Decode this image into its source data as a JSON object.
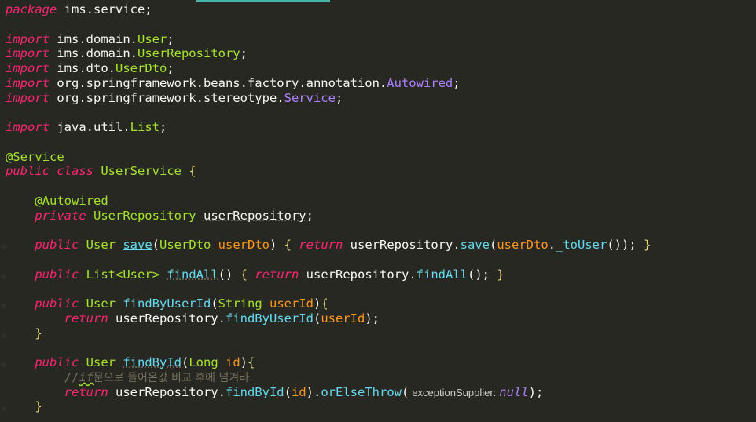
{
  "code": {
    "l1_kw": "package",
    "l1_name": " ims.service;",
    "import_kw": "import",
    "l3_pkg": " ims.domain.",
    "l3_cls": "User",
    "l3_semi": ";",
    "l4_pkg": " ims.domain.",
    "l4_cls": "UserRepository",
    "l4_semi": ";",
    "l5_pkg": " ims.dto.",
    "l5_cls": "UserDto",
    "l5_semi": ";",
    "l6_pkg": " org.springframework.beans.factory.annotation.",
    "l6_cls": "Autowired",
    "l6_semi": ";",
    "l7_pkg": " org.springframework.stereotype.",
    "l7_cls": "Service",
    "l7_semi": ";",
    "l9_pkg": " java.util.",
    "l9_cls": "List",
    "l9_semi": ";",
    "l11_ann": "@Service",
    "l12_kw1": "public",
    "l12_kw2": " class",
    "l12_cls": " UserService",
    "l12_brace": " {",
    "l14_ann": "    @Autowired",
    "l15_kw": "    private",
    "l15_type": " UserRepository",
    "l15_field": "userRepository",
    "l15_semi": ";",
    "l17_kw": "    public",
    "l17_type": " User",
    "l17_fn": "save",
    "l17_p1": "(",
    "l17_ptype": "UserDto",
    "l17_pname": " userDto",
    "l17_p2": ")",
    "l17_b1": " {",
    "l17_ret": " return",
    "l17_obj": " userRepository",
    "l17_dot": ".",
    "l17_call": "save",
    "l17_args1": "(",
    "l17_arg": "userDto",
    "l17_dot2": ".",
    "l17_call2": "_toUser",
    "l17_end": "()); ",
    "l17_b2": "}",
    "l19_kw": "    public",
    "l19_type": " List",
    "l19_gen": "<User>",
    "l19_fn": "findAll",
    "l19_p": "()",
    "l19_b1": " {",
    "l19_ret": " return",
    "l19_obj": " userRepository",
    "l19_dot": ".",
    "l19_call": "findAll",
    "l19_end": "(); ",
    "l19_b2": "}",
    "l21_kw": "    public",
    "l21_type": " User",
    "l21_fn": " findByUserId",
    "l21_p1": "(",
    "l21_ptype": "String",
    "l21_pname": " userId",
    "l21_p2": ")",
    "l21_b": "{",
    "l22_ret": "        return",
    "l22_obj": " userRepository",
    "l22_dot": ".",
    "l22_call": "findByUserId",
    "l22_p1": "(",
    "l22_arg": "userId",
    "l22_end": ");",
    "l23_b": "    }",
    "l25_kw": "    public",
    "l25_type": " User",
    "l25_fn": "findById",
    "l25_p1": "(",
    "l25_ptype": "Long",
    "l25_pname": " id",
    "l25_p2": ")",
    "l25_b": "{",
    "l26_comment_a": "        //",
    "l26_comment_if": "if",
    "l26_comment_b": "문으로 들어온값 비교 후에 넘겨라.",
    "l27_ret": "        return",
    "l27_obj": " userRepository",
    "l27_dot": ".",
    "l27_call": "findById",
    "l27_p1": "(",
    "l27_arg": "id",
    "l27_p2": ").",
    "l27_call2": "orElseThrow",
    "l27_p3": "(",
    "l27_hint": "exceptionSupplier:",
    "l27_null": "null",
    "l27_end": ");",
    "l28_b": "    }"
  },
  "colors": {
    "background": "#272822",
    "keyword": "#f92672",
    "type": "#a6e22e",
    "method": "#66d9ef",
    "param": "#fd971f",
    "literal": "#ae81ff",
    "comment": "#75715e"
  }
}
